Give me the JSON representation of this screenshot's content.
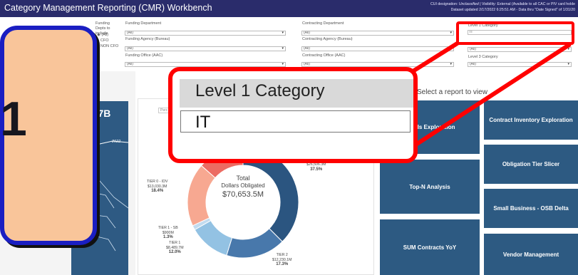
{
  "header": {
    "title": "Category Management Reporting (CMR) Workbench",
    "meta_line1_prefix": "CUI designation: ",
    "meta_line1_cui": "Unclassified",
    "meta_line1_suffix": " | Visibility: External (Available to all CAC or PIV card holde",
    "meta_line2": "Dataset updated 2/17/2022 6:25:51 AM - Data thru \"Date Signed\" of 1/31/20"
  },
  "filters": {
    "funding_depts_label": "Funding Depts to include",
    "radio_options": [
      "(All)",
      "CFO",
      "NON CFO"
    ],
    "funding_department": {
      "label": "Funding Department",
      "value": "(All)"
    },
    "funding_agency": {
      "label": "Funding Agency (Bureau)",
      "value": "(All)"
    },
    "funding_office": {
      "label": "Funding Office (AAC)",
      "value": "(All)"
    },
    "contracting_department": {
      "label": "Contracting Department",
      "value": "(All)"
    },
    "contracting_agency": {
      "label": "Contracting Agency (Bureau)",
      "value": "(All)"
    },
    "contracting_office": {
      "label": "Contracting Office (AAC)",
      "value": "(All)"
    },
    "level1_category": {
      "label": "Level 1 Category",
      "value": "IT"
    },
    "level2_category": {
      "value": "(All)"
    },
    "level3_category": {
      "label": "Level 3 Category",
      "value": "(All)"
    }
  },
  "left": {
    "metric": "70.7B",
    "year": "2022"
  },
  "donut": {
    "toggle": "Perc",
    "total_label1": "Total",
    "total_label2": "Dollars Obligated",
    "total_value": "$70,653.5M",
    "segments": [
      {
        "name": "TIER 0 - IDV",
        "amount": "$13,030.3M",
        "pct": "18.4%",
        "share": 18.4,
        "color": "#f7a891"
      },
      {
        "name": "TIER 1 - SB",
        "amount": "$900M",
        "pct": "1.3%",
        "share": 1.3,
        "color": "#c2dbef"
      },
      {
        "name": "TIER 1",
        "amount": "$8,489.7M",
        "pct": "12.0%",
        "share": 12.0,
        "color": "#93c2e3"
      },
      {
        "name": "TIER 2",
        "amount": "$12,230.1M",
        "pct": "17.3%",
        "share": 17.3,
        "color": "#4878ab"
      },
      {
        "name": "",
        "amount": "$26,506.3M",
        "pct": "37.5%",
        "share": 37.5,
        "color": "#2b5580"
      },
      {
        "name": "",
        "amount": "",
        "pct": "",
        "share": 13.5,
        "color": "#ec6b62"
      }
    ]
  },
  "reports": {
    "heading": "Select a report to view",
    "buttons": [
      "ds Exploration",
      "Contract Inventory Exploration",
      "Obligation Tier Slicer",
      "Top-N Analysis",
      "Small Business - OSB Delta",
      "SUM Contracts YoY",
      "Vendor Management"
    ]
  },
  "callout": {
    "number": "1"
  },
  "zoom": {
    "label": "Level 1 Category",
    "value": "IT"
  },
  "colors": {
    "header": "#2a2c6b",
    "tile": "#2d5a82",
    "highlight": "#ff0000",
    "callout_fill": "#f9c59a",
    "callout_border": "#1a1ec2"
  }
}
